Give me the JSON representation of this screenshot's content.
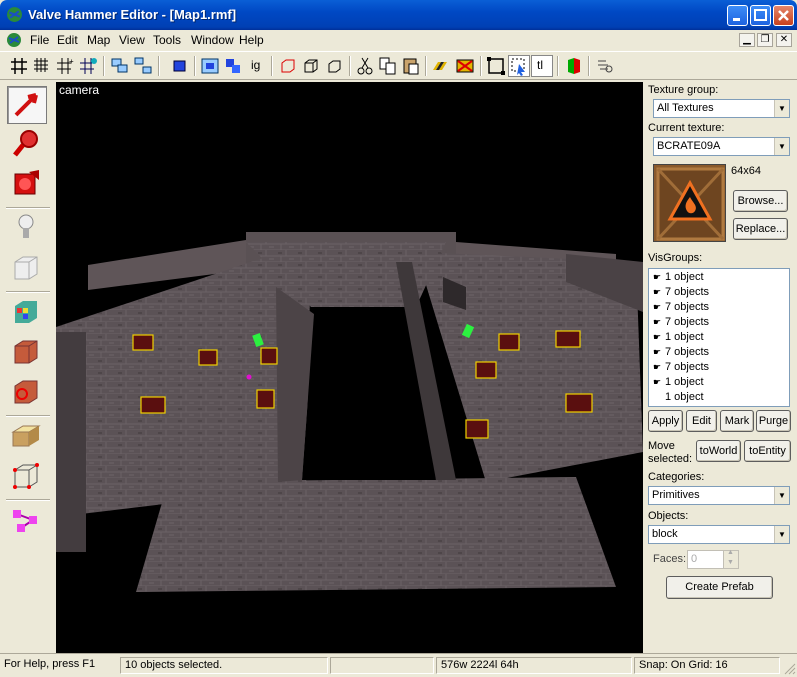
{
  "window": {
    "title": "Valve Hammer Editor - [Map1.rmf]"
  },
  "menu": [
    "File",
    "Edit",
    "Map",
    "View",
    "Tools",
    "Window",
    "Help"
  ],
  "toolbar_icons": [
    "grid-icon",
    "grid-smaller-icon",
    "grid-larger-icon",
    "grid-3d-icon",
    "group-icon",
    "ungroup-icon",
    "carve-icon",
    "hide-icon",
    "show-icon",
    "ignore-groups-icon",
    "texture-lock-icon",
    "clip-icon",
    "vertex-icon",
    "cut-icon",
    "copy-icon",
    "paste-icon",
    "decal-icon",
    "toggle-face-icon",
    "select-face-icon",
    "select-group-icon",
    "texture-label-icon",
    "run-map-icon",
    "script-icon"
  ],
  "toolbar": {
    "ignore_groups_label": "ig",
    "texture_lock_label": "tl"
  },
  "tools": [
    "selection-tool-icon",
    "magnify-tool-icon",
    "camera-tool-icon",
    "entity-tool-icon",
    "block-tool-icon",
    "texture-app-icon",
    "apply-texture-icon",
    "decal-tool-icon",
    "clipping-tool-icon",
    "vertex-tool-icon",
    "path-tool-icon"
  ],
  "viewport": {
    "label": "camera"
  },
  "panel": {
    "texture_group_label": "Texture group:",
    "texture_group_value": "All Textures",
    "current_texture_label": "Current texture:",
    "current_texture_value": "BCRATE09A",
    "texture_size": "64x64",
    "browse": "Browse...",
    "replace": "Replace...",
    "visgroups_label": "VisGroups:",
    "visgroups": [
      {
        "label": "1 object",
        "visible": true
      },
      {
        "label": "7 objects",
        "visible": true
      },
      {
        "label": "7 objects",
        "visible": true
      },
      {
        "label": "7 objects",
        "visible": true
      },
      {
        "label": "1 object",
        "visible": true
      },
      {
        "label": "7 objects",
        "visible": true
      },
      {
        "label": "7 objects",
        "visible": true
      },
      {
        "label": "1 object",
        "visible": true
      },
      {
        "label": "1 object",
        "visible": false
      }
    ],
    "apply": "Apply",
    "edit": "Edit",
    "mark": "Mark",
    "purge": "Purge",
    "move_selected": "Move selected:",
    "to_world": "toWorld",
    "to_entity": "toEntity",
    "categories_label": "Categories:",
    "categories_value": "Primitives",
    "objects_label": "Objects:",
    "objects_value": "block",
    "faces_label": "Faces:",
    "faces_value": "0",
    "create_prefab": "Create Prefab"
  },
  "status": {
    "help": "For Help, press F1",
    "selection": "10 objects selected.",
    "blank": "",
    "size": "576w 2224l 64h",
    "snap": "Snap: On Grid: 16"
  }
}
